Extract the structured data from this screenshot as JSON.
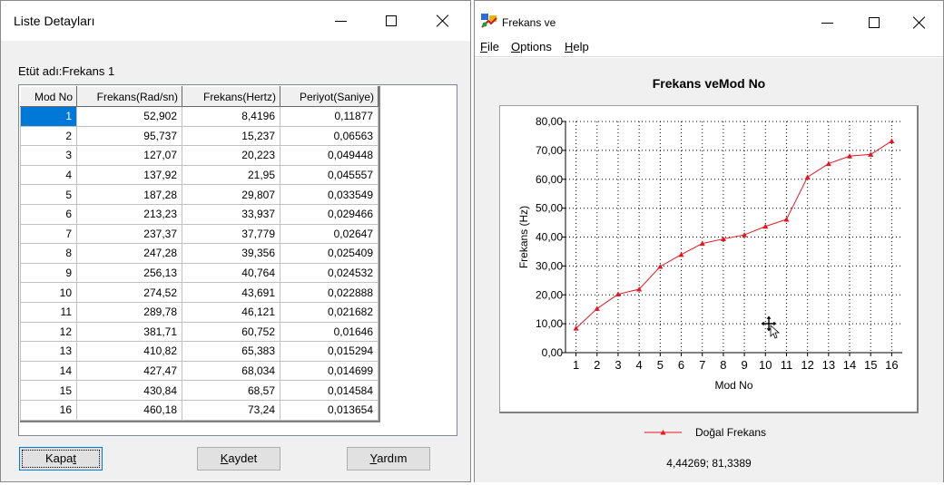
{
  "left_window": {
    "title": "Liste Detayları",
    "study_label": "Etüt adı:Frekans 1",
    "columns": [
      "Mod No",
      "Frekans(Rad/sn)",
      "Frekans(Hertz)",
      "Periyot(Saniye)"
    ],
    "rows": [
      [
        "1",
        "52,902",
        "8,4196",
        "0,11877"
      ],
      [
        "2",
        "95,737",
        "15,237",
        "0,06563"
      ],
      [
        "3",
        "127,07",
        "20,223",
        "0,049448"
      ],
      [
        "4",
        "137,92",
        "21,95",
        "0,045557"
      ],
      [
        "5",
        "187,28",
        "29,807",
        "0,033549"
      ],
      [
        "6",
        "213,23",
        "33,937",
        "0,029466"
      ],
      [
        "7",
        "237,37",
        "37,779",
        "0,02647"
      ],
      [
        "8",
        "247,28",
        "39,356",
        "0,025409"
      ],
      [
        "9",
        "256,13",
        "40,764",
        "0,024532"
      ],
      [
        "10",
        "274,52",
        "43,691",
        "0,022888"
      ],
      [
        "11",
        "289,78",
        "46,121",
        "0,021682"
      ],
      [
        "12",
        "381,71",
        "60,752",
        "0,01646"
      ],
      [
        "13",
        "410,82",
        "65,383",
        "0,015294"
      ],
      [
        "14",
        "427,47",
        "68,034",
        "0,014699"
      ],
      [
        "15",
        "430,84",
        "68,57",
        "0,014584"
      ],
      [
        "16",
        "460,18",
        "73,24",
        "0,013654"
      ]
    ],
    "selected_row": 0,
    "buttons": {
      "close_pre": "Kapa",
      "close_ul": "t",
      "close_post": "",
      "save_pre": "",
      "save_ul": "K",
      "save_post": "aydet",
      "help_pre": "",
      "help_ul": "Y",
      "help_post": "ardım"
    }
  },
  "right_window": {
    "title": "Frekans ve",
    "menu": {
      "file_ul": "F",
      "file_rest": "ile",
      "options_ul": "O",
      "options_rest": "ptions",
      "help_ul": "H",
      "help_rest": "elp"
    },
    "cursor_readout": "4,44269; 81,3389"
  },
  "chart_data": {
    "type": "line",
    "title": "Frekans veMod No",
    "xlabel": "Mod No",
    "ylabel": "Frekans (Hz)",
    "x": [
      1,
      2,
      3,
      4,
      5,
      6,
      7,
      8,
      9,
      10,
      11,
      12,
      13,
      14,
      15,
      16
    ],
    "xlim": [
      0.5,
      16.5
    ],
    "ylim": [
      0,
      80
    ],
    "yticks": [
      0,
      10,
      20,
      30,
      40,
      50,
      60,
      70,
      80
    ],
    "ytick_labels": [
      "0,00",
      "10,00",
      "20,00",
      "30,00",
      "40,00",
      "50,00",
      "60,00",
      "70,00",
      "80,00"
    ],
    "grid": true,
    "legend_position": "bottom",
    "series": [
      {
        "name": "Doğal Frekans",
        "color": "#e8141e",
        "marker": "triangle",
        "values": [
          8.4196,
          15.237,
          20.223,
          21.95,
          29.807,
          33.937,
          37.779,
          39.356,
          40.764,
          43.691,
          46.121,
          60.752,
          65.383,
          68.034,
          68.57,
          73.24
        ]
      }
    ]
  },
  "colors": {
    "selection": "#0078d7",
    "series_red": "#e8141e",
    "window_bg": "#f0f0f0"
  }
}
